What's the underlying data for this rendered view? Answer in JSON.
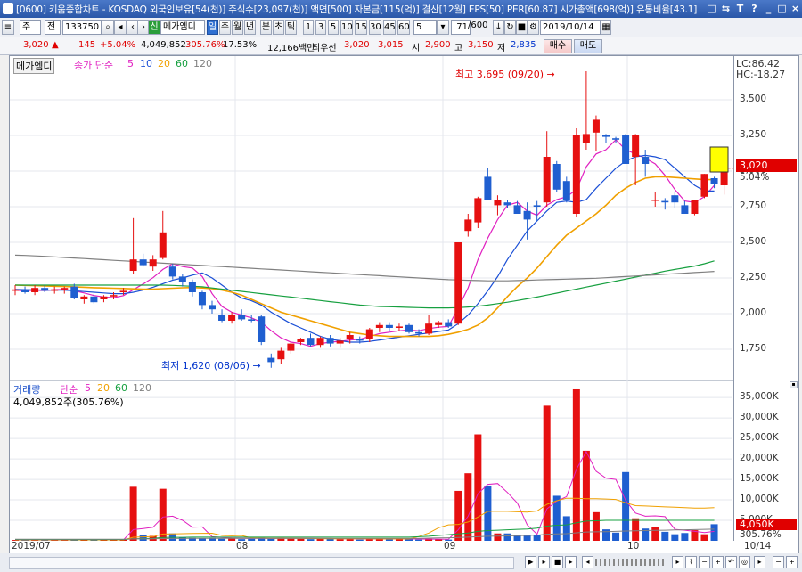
{
  "window": {
    "title": "[0600] 키움종합차트 - KOSDAQ 외국인보유[54(천)] 주식수[23,097(천)] 액면[500] 자본금[115(억)] 결산[12월] EPS[50] PER[60.87] 시가총액[698(억)] 유통비율[43.1]",
    "controls": [
      "□",
      "⇆",
      "T",
      "?",
      "_",
      "□",
      "×"
    ]
  },
  "toolbar": {
    "period_select": "주",
    "mode_select": "전",
    "code": "133750",
    "stock_tag": "신",
    "stock_name": "메가엠디",
    "periods": [
      "일",
      "주",
      "월",
      "년",
      "분",
      "초",
      "틱"
    ],
    "active_period": "일",
    "minutes": [
      "1",
      "3",
      "5",
      "10",
      "15",
      "30",
      "45",
      "60"
    ],
    "minute_value": "5",
    "count": "71",
    "count_total": "/600",
    "date": "2019/10/14"
  },
  "quote": {
    "price": "3,020",
    "price_arrow": "▲",
    "change": "145",
    "change_pct": "+5.04%",
    "volume": "4,049,852",
    "volume_ratio": "305.76%",
    "turnover": "17.53%",
    "amount": "12,166백만",
    "priority_label": "최우선",
    "ask": "3,020",
    "bid": "3,015",
    "open_label": "시",
    "open": "2,900",
    "high_label": "고",
    "high": "3,150",
    "low_label": "저",
    "low": "2,835",
    "buy": "매수",
    "sell": "매도"
  },
  "price_panel": {
    "stock_label": "메가엠디",
    "ma_label": "종가 단순",
    "ma_periods": [
      "5",
      "10",
      "20",
      "60",
      "120"
    ],
    "ma_colors": [
      "#e020c0",
      "#1a4fd6",
      "#f0a000",
      "#17a040",
      "#808080"
    ],
    "lc": "LC:86.42",
    "hc": "HC:-18.27",
    "current_price": "3,020",
    "current_pct": "5.04%",
    "max_annotation": "최고 3,695 (09/20) →",
    "min_annotation": "최저 1,620 (08/06) →",
    "y_ticks": [
      "3,500",
      "3,250",
      "3,000",
      "2,750",
      "2,500",
      "2,250",
      "2,000",
      "1,750"
    ]
  },
  "volume_panel": {
    "label": "거래량",
    "ma_label": "단순",
    "ma_periods": [
      "5",
      "20",
      "60",
      "120"
    ],
    "ma_colors": [
      "#e020c0",
      "#f0a000",
      "#17a040",
      "#808080"
    ],
    "volume_text": "4,049,852주(305.76%)",
    "current_volume": "4,050K",
    "current_pct": "305.76%",
    "y_ticks": [
      "35,000K",
      "30,000K",
      "25,000K",
      "20,000K",
      "15,000K",
      "10,000K",
      "5,000K"
    ]
  },
  "x_axis": {
    "labels": [
      "2019/07",
      "08",
      "09",
      "10"
    ],
    "last_date": "10/14"
  },
  "chart_data": {
    "type": "candlestick",
    "x": [
      "2019/07",
      "08",
      "09",
      "10",
      "10/14"
    ],
    "ylim": [
      1620,
      3695
    ],
    "candles": [
      {
        "o": 2160,
        "h": 2200,
        "l": 2130,
        "c": 2170
      },
      {
        "o": 2170,
        "h": 2190,
        "l": 2140,
        "c": 2150
      },
      {
        "o": 2150,
        "h": 2200,
        "l": 2130,
        "c": 2180
      },
      {
        "o": 2180,
        "h": 2200,
        "l": 2150,
        "c": 2160
      },
      {
        "o": 2160,
        "h": 2190,
        "l": 2140,
        "c": 2170
      },
      {
        "o": 2170,
        "h": 2190,
        "l": 2140,
        "c": 2180
      },
      {
        "o": 2190,
        "h": 2210,
        "l": 2100,
        "c": 2110
      },
      {
        "o": 2100,
        "h": 2130,
        "l": 2070,
        "c": 2120
      },
      {
        "o": 2120,
        "h": 2140,
        "l": 2070,
        "c": 2080
      },
      {
        "o": 2100,
        "h": 2130,
        "l": 2080,
        "c": 2120
      },
      {
        "o": 2120,
        "h": 2150,
        "l": 2100,
        "c": 2130
      },
      {
        "o": 2150,
        "h": 2180,
        "l": 2130,
        "c": 2160
      },
      {
        "o": 2300,
        "h": 2670,
        "l": 2280,
        "c": 2380
      },
      {
        "o": 2380,
        "h": 2420,
        "l": 2330,
        "c": 2340
      },
      {
        "o": 2330,
        "h": 2410,
        "l": 2300,
        "c": 2380
      },
      {
        "o": 2390,
        "h": 2720,
        "l": 2380,
        "c": 2570
      },
      {
        "o": 2330,
        "h": 2350,
        "l": 2240,
        "c": 2260
      },
      {
        "o": 2260,
        "h": 2280,
        "l": 2190,
        "c": 2220
      },
      {
        "o": 2220,
        "h": 2240,
        "l": 2120,
        "c": 2150
      },
      {
        "o": 2150,
        "h": 2160,
        "l": 2030,
        "c": 2060
      },
      {
        "o": 2060,
        "h": 2090,
        "l": 2000,
        "c": 2030
      },
      {
        "o": 1990,
        "h": 2030,
        "l": 1940,
        "c": 1950
      },
      {
        "o": 1950,
        "h": 2010,
        "l": 1930,
        "c": 1990
      },
      {
        "o": 1990,
        "h": 2030,
        "l": 1950,
        "c": 1960
      },
      {
        "o": 1960,
        "h": 1990,
        "l": 1940,
        "c": 1950
      },
      {
        "o": 1980,
        "h": 1990,
        "l": 1780,
        "c": 1800
      },
      {
        "o": 1690,
        "h": 1720,
        "l": 1620,
        "c": 1660
      },
      {
        "o": 1680,
        "h": 1760,
        "l": 1650,
        "c": 1740
      },
      {
        "o": 1740,
        "h": 1800,
        "l": 1720,
        "c": 1790
      },
      {
        "o": 1800,
        "h": 1830,
        "l": 1780,
        "c": 1820
      },
      {
        "o": 1830,
        "h": 1860,
        "l": 1770,
        "c": 1780
      },
      {
        "o": 1780,
        "h": 1840,
        "l": 1760,
        "c": 1830
      },
      {
        "o": 1830,
        "h": 1850,
        "l": 1770,
        "c": 1790
      },
      {
        "o": 1790,
        "h": 1830,
        "l": 1760,
        "c": 1810
      },
      {
        "o": 1820,
        "h": 1870,
        "l": 1790,
        "c": 1850
      },
      {
        "o": 1820,
        "h": 1840,
        "l": 1790,
        "c": 1810
      },
      {
        "o": 1820,
        "h": 1900,
        "l": 1800,
        "c": 1890
      },
      {
        "o": 1900,
        "h": 1940,
        "l": 1870,
        "c": 1920
      },
      {
        "o": 1920,
        "h": 1940,
        "l": 1880,
        "c": 1900
      },
      {
        "o": 1900,
        "h": 1930,
        "l": 1880,
        "c": 1910
      },
      {
        "o": 1920,
        "h": 1930,
        "l": 1860,
        "c": 1870
      },
      {
        "o": 1870,
        "h": 1890,
        "l": 1840,
        "c": 1860
      },
      {
        "o": 1860,
        "h": 1990,
        "l": 1850,
        "c": 1930
      },
      {
        "o": 1920,
        "h": 1950,
        "l": 1900,
        "c": 1940
      },
      {
        "o": 1940,
        "h": 1960,
        "l": 1900,
        "c": 1910
      },
      {
        "o": 1930,
        "h": 2500,
        "l": 1920,
        "c": 2500
      },
      {
        "o": 2580,
        "h": 2700,
        "l": 2540,
        "c": 2660
      },
      {
        "o": 2640,
        "h": 2820,
        "l": 2600,
        "c": 2810
      },
      {
        "o": 2960,
        "h": 3020,
        "l": 2800,
        "c": 2800
      },
      {
        "o": 2760,
        "h": 2830,
        "l": 2690,
        "c": 2800
      },
      {
        "o": 2780,
        "h": 2800,
        "l": 2740,
        "c": 2760
      },
      {
        "o": 2760,
        "h": 2790,
        "l": 2700,
        "c": 2700
      },
      {
        "o": 2720,
        "h": 2780,
        "l": 2520,
        "c": 2660
      },
      {
        "o": 2760,
        "h": 2790,
        "l": 2650,
        "c": 2750
      },
      {
        "o": 2780,
        "h": 3280,
        "l": 2750,
        "c": 3100
      },
      {
        "o": 3050,
        "h": 3070,
        "l": 2850,
        "c": 2870
      },
      {
        "o": 2930,
        "h": 2960,
        "l": 2780,
        "c": 2800
      },
      {
        "o": 2700,
        "h": 3300,
        "l": 2680,
        "c": 3250
      },
      {
        "o": 3200,
        "h": 3700,
        "l": 3150,
        "c": 3260
      },
      {
        "o": 3270,
        "h": 3390,
        "l": 3140,
        "c": 3360
      },
      {
        "o": 3250,
        "h": 3260,
        "l": 3200,
        "c": 3240
      },
      {
        "o": 3230,
        "h": 3240,
        "l": 3200,
        "c": 3220
      },
      {
        "o": 3250,
        "h": 3260,
        "l": 3050,
        "c": 3050
      },
      {
        "o": 3100,
        "h": 3260,
        "l": 2900,
        "c": 3250
      },
      {
        "o": 3100,
        "h": 3150,
        "l": 2960,
        "c": 3050
      },
      {
        "o": 2800,
        "h": 2850,
        "l": 2750,
        "c": 2800
      },
      {
        "o": 2790,
        "h": 2810,
        "l": 2730,
        "c": 2780
      },
      {
        "o": 2830,
        "h": 2850,
        "l": 2740,
        "c": 2780
      },
      {
        "o": 2760,
        "h": 2790,
        "l": 2700,
        "c": 2700
      },
      {
        "o": 2700,
        "h": 2800,
        "l": 2690,
        "c": 2800
      },
      {
        "o": 2820,
        "h": 2980,
        "l": 2810,
        "c": 2980
      },
      {
        "o": 2950,
        "h": 2960,
        "l": 2880,
        "c": 2910
      },
      {
        "o": 2900,
        "h": 3150,
        "l": 2835,
        "c": 3020
      }
    ],
    "volume_k": [
      200,
      150,
      200,
      150,
      150,
      200,
      300,
      200,
      150,
      200,
      200,
      250,
      13200,
      1500,
      1200,
      12700,
      1800,
      800,
      700,
      600,
      700,
      500,
      600,
      400,
      500,
      800,
      500,
      700,
      600,
      500,
      400,
      600,
      500,
      400,
      500,
      300,
      500,
      600,
      400,
      500,
      400,
      300,
      500,
      400,
      300,
      12200,
      16500,
      26000,
      13500,
      1800,
      1800,
      1500,
      1300,
      1500,
      33000,
      11000,
      6000,
      37000,
      22000,
      7000,
      2800,
      2000,
      16800,
      5500,
      3000,
      3300,
      2200,
      1600,
      1900,
      2600,
      1600,
      4050
    ],
    "ma_prices": {
      "ma5": [
        2165,
        2160,
        2165,
        2162,
        2168,
        2170,
        2160,
        2145,
        2127,
        2116,
        2112,
        2126,
        2168,
        2208,
        2252,
        2310,
        2350,
        2330,
        2320,
        2260,
        2140,
        2050,
        2010,
        1990,
        1970,
        1940,
        1880,
        1830,
        1800,
        1790,
        1770,
        1790,
        1800,
        1805,
        1815,
        1820,
        1840,
        1860,
        1870,
        1880,
        1885,
        1880,
        1895,
        1905,
        1910,
        2040,
        2180,
        2380,
        2530,
        2660,
        2760,
        2780,
        2720,
        2690,
        2760,
        2800,
        2820,
        2870,
        3030,
        3120,
        3150,
        3220,
        3150,
        3120,
        3090,
        3050,
        2970,
        2870,
        2790,
        2780,
        2820,
        2900
      ],
      "ma10": [
        2170,
        2168,
        2166,
        2165,
        2165,
        2165,
        2160,
        2155,
        2150,
        2145,
        2140,
        2140,
        2150,
        2165,
        2185,
        2210,
        2235,
        2250,
        2270,
        2285,
        2250,
        2200,
        2150,
        2110,
        2090,
        2060,
        2010,
        1970,
        1930,
        1900,
        1870,
        1840,
        1820,
        1810,
        1800,
        1800,
        1805,
        1815,
        1825,
        1835,
        1845,
        1855,
        1865,
        1875,
        1885,
        1930,
        1990,
        2070,
        2160,
        2260,
        2380,
        2480,
        2580,
        2650,
        2720,
        2780,
        2790,
        2780,
        2800,
        2880,
        2950,
        3020,
        3070,
        3100,
        3110,
        3100,
        3080,
        3020,
        2960,
        2900,
        2860,
        2860
      ],
      "ma20": [
        2200,
        2198,
        2196,
        2194,
        2192,
        2190,
        2188,
        2185,
        2182,
        2180,
        2178,
        2176,
        2174,
        2172,
        2172,
        2175,
        2178,
        2181,
        2183,
        2180,
        2175,
        2165,
        2150,
        2130,
        2100,
        2070,
        2040,
        2010,
        1990,
        1970,
        1950,
        1930,
        1910,
        1890,
        1870,
        1860,
        1850,
        1845,
        1840,
        1840,
        1840,
        1840,
        1840,
        1845,
        1855,
        1870,
        1890,
        1920,
        1970,
        2040,
        2120,
        2190,
        2250,
        2320,
        2400,
        2480,
        2550,
        2600,
        2650,
        2700,
        2760,
        2830,
        2880,
        2920,
        2950,
        2960,
        2960,
        2955,
        2950,
        2945,
        2940,
        2940
      ],
      "ma60": [
        2200,
        2200,
        2200,
        2200,
        2200,
        2200,
        2200,
        2200,
        2200,
        2200,
        2200,
        2200,
        2200,
        2200,
        2200,
        2200,
        2198,
        2195,
        2192,
        2188,
        2180,
        2172,
        2164,
        2156,
        2148,
        2140,
        2132,
        2124,
        2116,
        2108,
        2100,
        2092,
        2084,
        2076,
        2068,
        2060,
        2055,
        2050,
        2048,
        2046,
        2044,
        2042,
        2040,
        2040,
        2040,
        2042,
        2046,
        2052,
        2060,
        2070,
        2080,
        2092,
        2104,
        2116,
        2130,
        2144,
        2158,
        2172,
        2186,
        2200,
        2214,
        2228,
        2242,
        2256,
        2270,
        2284,
        2298,
        2310,
        2322,
        2334,
        2350,
        2370
      ],
      "ma120": [
        2410,
        2408,
        2405,
        2402,
        2398,
        2394,
        2390,
        2386,
        2382,
        2378,
        2374,
        2370,
        2366,
        2362,
        2358,
        2354,
        2350,
        2346,
        2342,
        2338,
        2334,
        2330,
        2326,
        2322,
        2318,
        2314,
        2310,
        2306,
        2302,
        2298,
        2294,
        2290,
        2286,
        2282,
        2278,
        2274,
        2270,
        2266,
        2262,
        2258,
        2254,
        2250,
        2246,
        2242,
        2238,
        2236,
        2234,
        2232,
        2230,
        2230,
        2230,
        2232,
        2234,
        2236,
        2238,
        2240,
        2242,
        2244,
        2246,
        2248,
        2252,
        2256,
        2260,
        2264,
        2268,
        2272,
        2276,
        2280,
        2284,
        2288,
        2292,
        2296
      ]
    },
    "ma_volume": {
      "ma5": [
        200,
        200,
        200,
        200,
        200,
        200,
        220,
        220,
        220,
        220,
        220,
        230,
        2750,
        3000,
        3300,
        5800,
        6000,
        5000,
        3300,
        3400,
        1000,
        800,
        650,
        620,
        600,
        600,
        560,
        600,
        600,
        600,
        600,
        560,
        560,
        500,
        500,
        460,
        460,
        460,
        460,
        460,
        460,
        440,
        420,
        420,
        400,
        2700,
        6000,
        11500,
        13800,
        14000,
        11800,
        9200,
        3900,
        1600,
        7800,
        9700,
        10800,
        17500,
        21800,
        17000,
        15300,
        15000,
        9900,
        6800,
        6000,
        6100,
        5900,
        2800,
        2600,
        2300,
        2000,
        2300
      ],
      "ma20": [
        220,
        220,
        220,
        220,
        220,
        220,
        220,
        220,
        220,
        220,
        220,
        220,
        880,
        950,
        1020,
        1650,
        1700,
        1740,
        1790,
        1830,
        1850,
        1300,
        1220,
        1300,
        700,
        650,
        620,
        600,
        580,
        560,
        540,
        520,
        510,
        500,
        490,
        480,
        470,
        460,
        460,
        460,
        460,
        1050,
        1900,
        3200,
        3900,
        4000,
        4600,
        5800,
        7200,
        7200,
        7200,
        7100,
        7000,
        7300,
        8900,
        9800,
        10400,
        10400,
        10300,
        10300,
        10200,
        10100,
        9300,
        8600,
        8500,
        8400,
        8300,
        8200,
        8100,
        8000,
        8000,
        8100
      ],
      "ma60": [
        300,
        300,
        300,
        300,
        300,
        300,
        300,
        300,
        300,
        300,
        300,
        300,
        500,
        550,
        600,
        800,
        850,
        850,
        900,
        900,
        900,
        900,
        900,
        900,
        900,
        900,
        900,
        900,
        900,
        900,
        900,
        900,
        900,
        900,
        900,
        900,
        900,
        900,
        900,
        900,
        900,
        1000,
        1100,
        1300,
        1500,
        1700,
        1900,
        2300,
        2500,
        2600,
        2700,
        2800,
        2900,
        3100,
        3600,
        3800,
        3900,
        4400,
        4800,
        4900,
        5000,
        5000,
        5000,
        5000,
        5000,
        5000,
        5000,
        5000,
        5000,
        5000,
        5000,
        5000
      ],
      "ma120": [
        400,
        400,
        400,
        400,
        400,
        400,
        400,
        400,
        400,
        400,
        400,
        400,
        450,
        460,
        470,
        550,
        560,
        570,
        580,
        590,
        600,
        600,
        600,
        600,
        600,
        600,
        600,
        600,
        600,
        600,
        600,
        600,
        600,
        600,
        600,
        600,
        600,
        600,
        600,
        600,
        600,
        620,
        650,
        700,
        750,
        800,
        900,
        1000,
        1100,
        1150,
        1200,
        1250,
        1300,
        1400,
        1600,
        1700,
        1750,
        1950,
        2150,
        2200,
        2250,
        2300,
        2400,
        2450,
        2500,
        2550,
        2600,
        2650,
        2700,
        2750,
        2800,
        2850
      ]
    }
  }
}
